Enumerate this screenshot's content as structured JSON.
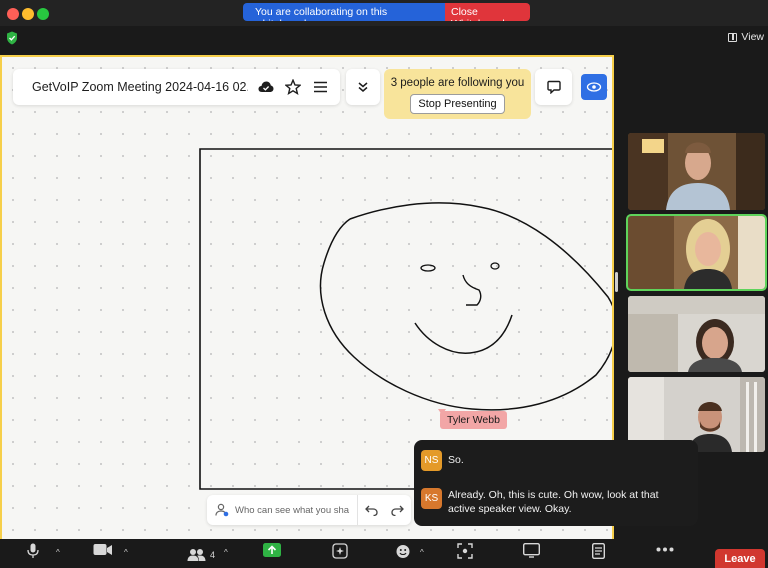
{
  "banner": {
    "message": "You are collaborating on this whiteboard",
    "close_label": "Close Whiteboard"
  },
  "view_label": "View",
  "whiteboard": {
    "title": "GetVoIP Zoom Meeting 2024-04-16 02...",
    "follow_text": "3 people are following you",
    "stop_label": "Stop Presenting",
    "cursor_name": "Tyler Webb",
    "share_placeholder": "Who can see what you sha"
  },
  "participants": {
    "count": "4"
  },
  "chat": [
    {
      "initials": "NS",
      "text": "So."
    },
    {
      "initials": "KS",
      "text": "Already. Oh, this is cute. Oh wow, look at that active speaker view. Okay."
    }
  ],
  "toolbar": {
    "leave_label": "Leave"
  },
  "colors": {
    "accent": "#2f6fe4",
    "board_border": "#f6cf4a",
    "leave": "#d1372f",
    "active_speaker": "#5fd35b"
  }
}
